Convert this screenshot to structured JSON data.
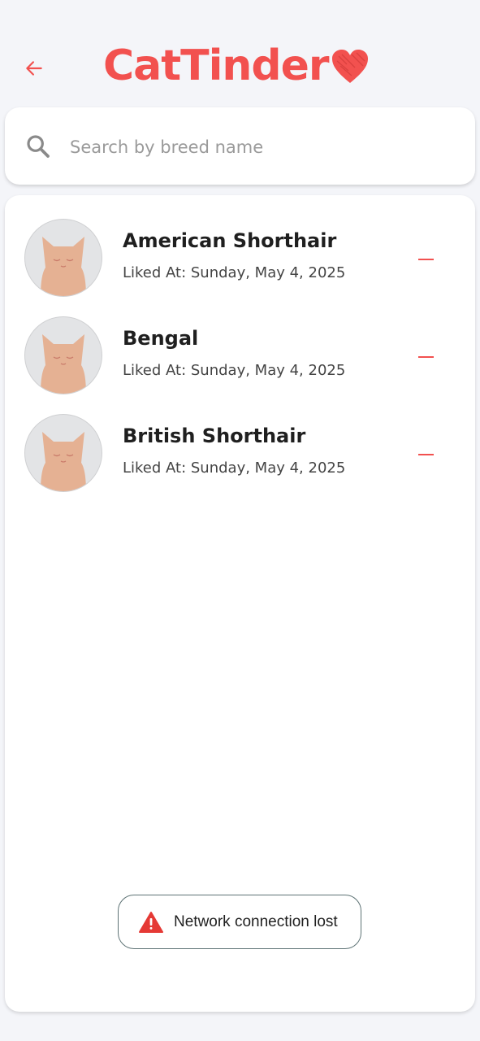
{
  "colors": {
    "accent": "#f2514f",
    "background": "#f4f5f9",
    "card": "#ffffff",
    "avatar_bg": "#e3e4e6",
    "cat": "#e5b193",
    "toast_border": "#5e7375",
    "warning": "#e53935"
  },
  "header": {
    "back_icon": "arrow-left-icon",
    "title": "CatTinder",
    "title_icon": "heart-icon"
  },
  "search": {
    "icon": "search-icon",
    "placeholder": "Search by breed name",
    "value": ""
  },
  "liked_cats": [
    {
      "name": "American Shorthair",
      "liked_at": "Liked At: Sunday, May 4, 2025",
      "avatar_icon": "cat-icon",
      "action_icon": "minus-icon"
    },
    {
      "name": "Bengal",
      "liked_at": "Liked At: Sunday, May 4, 2025",
      "avatar_icon": "cat-icon",
      "action_icon": "minus-icon"
    },
    {
      "name": "British Shorthair",
      "liked_at": "Liked At: Sunday, May 4, 2025",
      "avatar_icon": "cat-icon",
      "action_icon": "minus-icon"
    }
  ],
  "toast": {
    "icon": "warning-icon",
    "message": "Network connection lost"
  }
}
